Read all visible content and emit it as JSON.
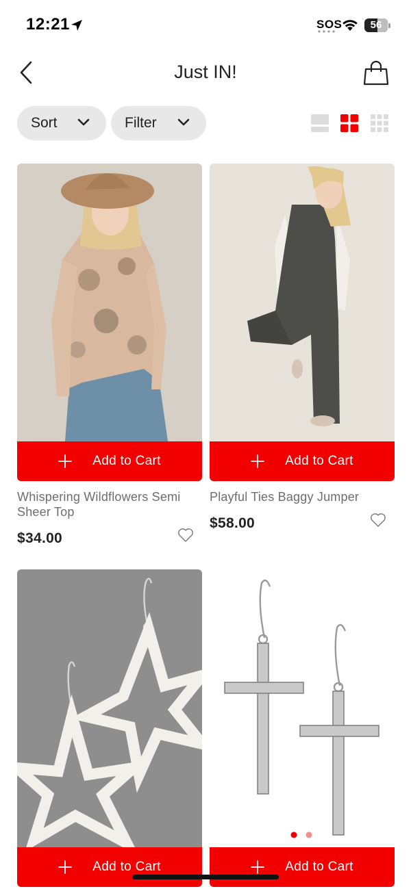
{
  "status_bar": {
    "time": "12:21",
    "sos": "SOS",
    "battery": "56",
    "battery_level": 0.56,
    "icons": [
      "location-arrow-icon",
      "wifi-icon",
      "battery-icon"
    ]
  },
  "header": {
    "title": "Just IN!",
    "back_icon": "chevron-left-icon",
    "bag_icon": "shopping-bag-icon"
  },
  "toolbar": {
    "sort_label": "Sort",
    "filter_label": "Filter",
    "view_modes": [
      "list-view-icon",
      "grid-2-view-icon",
      "grid-3-view-icon"
    ],
    "active_view": "grid-2-view-icon"
  },
  "colors": {
    "accent": "#f20000",
    "pill_bg": "#e8e8e8",
    "inactive_icon": "#dcdcdc"
  },
  "products": [
    {
      "name": "Whispering Wildflowers Semi Sheer Top",
      "price": "$34.00",
      "cart_label": "Add to Cart",
      "favorited": false
    },
    {
      "name": "Playful Ties Baggy Jumper",
      "price": "$58.00",
      "cart_label": "Add to Cart",
      "favorited": false
    },
    {
      "name": "",
      "price": "",
      "cart_label": "Add to Cart",
      "favorited": false
    },
    {
      "name": "",
      "price": "",
      "cart_label": "Add to Cart",
      "favorited": false,
      "image_pages": 2,
      "image_page_current": 1
    }
  ]
}
